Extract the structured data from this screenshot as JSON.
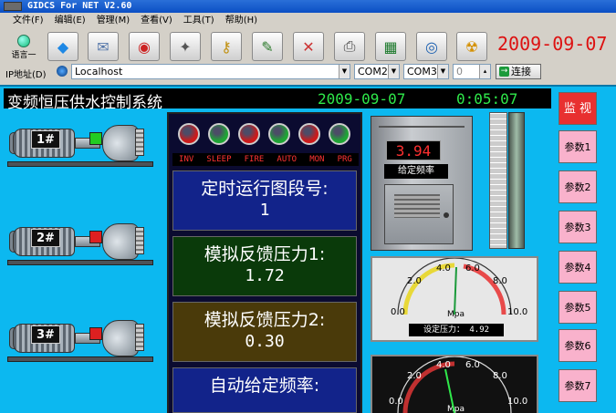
{
  "window": {
    "title": "GIDCS For NET V2.60"
  },
  "menu": [
    "文件(F)",
    "编辑(E)",
    "管理(M)",
    "查看(V)",
    "工具(T)",
    "帮助(H)"
  ],
  "toolbar": {
    "language_label": "语言一",
    "buttons": [
      "edit-icon",
      "connect-icon",
      "monitor-icon",
      "settings-icon",
      "keys-icon",
      "tools-icon",
      "cancel-icon",
      "print-icon",
      "excel-icon",
      "network-icon",
      "hazard-icon"
    ],
    "date": "2009-09-07"
  },
  "address": {
    "label": "IP地址(D)",
    "ip_value": "Localhost",
    "com_a": "COM2",
    "com_b": "COM3",
    "number_value": "0",
    "connect_label": "连接"
  },
  "screen": {
    "title": "变频恒压供水控制系统",
    "date": "2009-09-07",
    "time": "0:05:07",
    "pumps": [
      {
        "tag": "1#",
        "status_color": "#22cc22"
      },
      {
        "tag": "2#",
        "status_color": "#dd2020"
      },
      {
        "tag": "3#",
        "status_color": "#dd2020"
      }
    ],
    "leds": [
      {
        "label": "INV",
        "color": "#cc1a1a"
      },
      {
        "label": "SLEEP",
        "color": "#1ea534"
      },
      {
        "label": "FIRE",
        "color": "#cc1a1a"
      },
      {
        "label": "AUTO",
        "color": "#1ea534"
      },
      {
        "label": "MON",
        "color": "#cc1a1a"
      },
      {
        "label": "PRG",
        "color": "#1ea534"
      }
    ],
    "blocks": [
      {
        "label": "定时运行图段号:",
        "value": "1",
        "color": "#12238a"
      },
      {
        "label": "模拟反馈压力1:",
        "value": "1.72",
        "color": "#0a3a0a"
      },
      {
        "label": "模拟反馈压力2:",
        "value": "0.30",
        "color": "#4a3a0a"
      },
      {
        "label": "自动给定频率:",
        "value": "",
        "color": "#12238a"
      }
    ],
    "freq_display": "3.94",
    "freq_caption": "给定频率",
    "gauge1": {
      "ticks": [
        "0.0",
        "2.0",
        "4.0",
        "6.0",
        "8.0",
        "10.0"
      ],
      "unit": "Mpa",
      "caption": "设定压力：",
      "value": "4.92"
    },
    "gauge2": {
      "ticks": [
        "0.0",
        "2.0",
        "4.0",
        "6.0",
        "8.0",
        "10.0"
      ],
      "unit": "Mpa"
    },
    "right_buttons": [
      "监 视",
      "参数1",
      "参数2",
      "参数3",
      "参数4",
      "参数5",
      "参数6",
      "参数7"
    ]
  }
}
